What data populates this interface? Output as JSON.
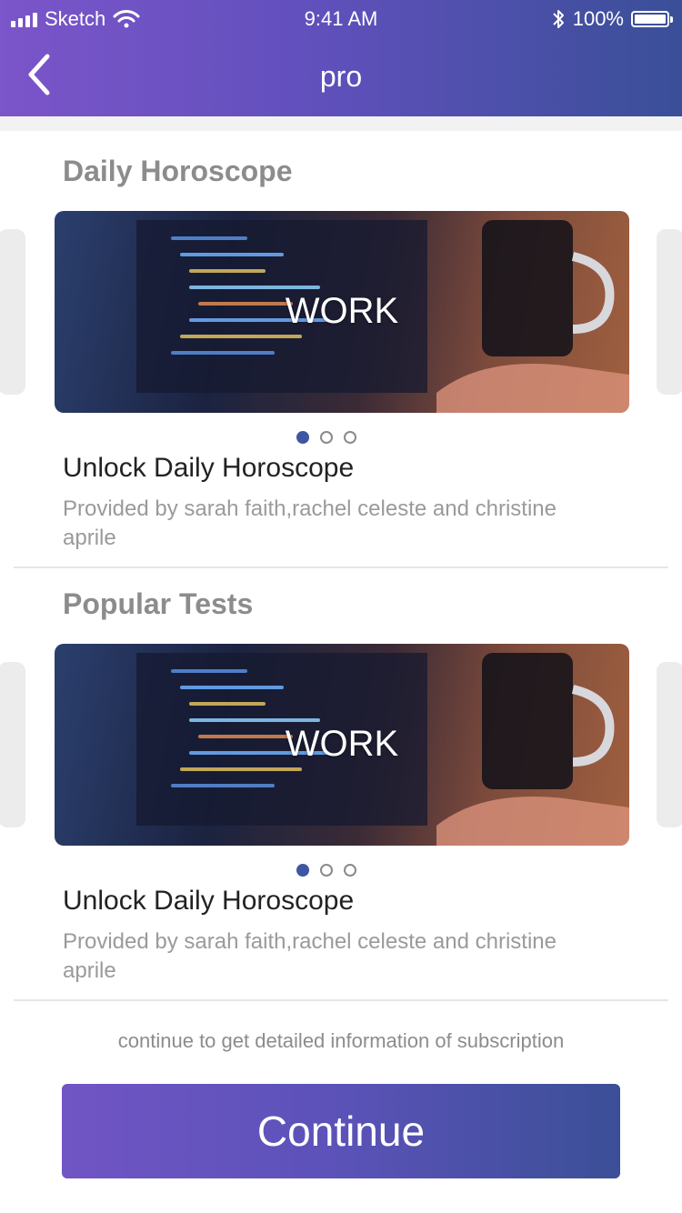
{
  "status_bar": {
    "carrier": "Sketch",
    "time": "9:41 AM",
    "battery_percent": "100%",
    "battery_level": 1.0
  },
  "nav": {
    "title": "pro",
    "back_icon": "chevron-left-icon"
  },
  "sections": [
    {
      "title": "Daily  Horoscope",
      "banner_text": "WORK",
      "carousel_page": 1,
      "carousel_total": 3,
      "item_title": "Unlock Daily Horoscope",
      "item_desc": "Provided by sarah faith,rachel celeste and christine aprile"
    },
    {
      "title": "Popular Tests",
      "banner_text": "WORK",
      "carousel_page": 1,
      "carousel_total": 3,
      "item_title": "Unlock Daily Horoscope",
      "item_desc": "Provided by sarah faith,rachel celeste and christine aprile"
    }
  ],
  "footer": {
    "note": "continue to get detailed information of subscription",
    "button_label": "Continue"
  },
  "colors": {
    "header_start": "#7b55c9",
    "header_end": "#3a4f98",
    "dot_active": "#3d57a3"
  }
}
